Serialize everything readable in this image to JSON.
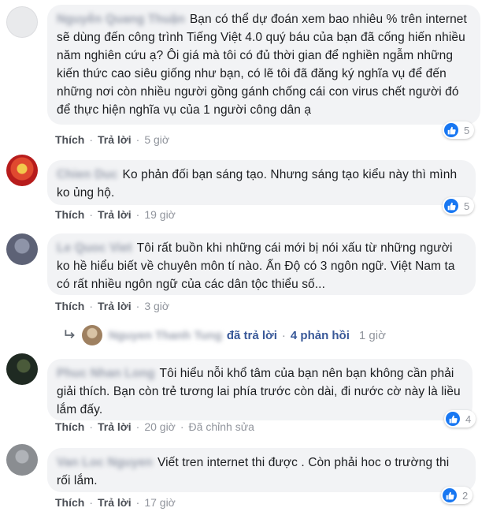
{
  "comments": [
    {
      "author": "Nguyễn Quang Thuận",
      "text": "Bạn có thể dự đoán xem bao nhiêu % trên internet sẽ dùng đến công trình Tiếng Việt 4.0 quý báu của bạn đã cống hiến nhiều năm nghiên cứu ạ? Ôi giá mà tôi có đủ thời gian để nghiền ngẫm những kiến thức cao siêu giống như bạn, có lẽ tôi đã đăng ký nghĩa vụ để đến những nơi còn nhiều người gồng gánh chống cái con virus chết người đó để thực hiện nghĩa vụ của 1 người công dân ạ",
      "like": "Thích",
      "reply": "Trả lời",
      "time": "5 giờ",
      "reactions": "5"
    },
    {
      "author": "Chien Duc",
      "text": "Ko phản đối bạn sáng tạo. Nhưng sáng tạo kiểu này thì mình ko ủng hộ.",
      "like": "Thích",
      "reply": "Trả lời",
      "time": "19 giờ",
      "reactions": "5"
    },
    {
      "author": "Le Quoc Viet",
      "text": "Tôi rất buồn khi những cái mới bị nói xấu từ những người ko hề hiểu biết về chuyên môn tí nào. Ấn Độ có 3 ngôn ngữ. Việt Nam ta có rất nhiều ngôn ngữ của các dân tộc thiểu số...",
      "like": "Thích",
      "reply": "Trả lời",
      "time": "3 giờ",
      "replies": {
        "name": "Nguyen Thanh Tung",
        "replied": "đã trả lời",
        "count": "4 phản hồi",
        "time": "1 giờ"
      }
    },
    {
      "author": "Phuc Nhan Long",
      "text": "Tôi hiểu nỗi khổ tâm của bạn nên bạn không cần phải giải thích. Bạn còn trẻ tương lai phía trước còn dài, đi nước cờ này là liều lắm đấy.",
      "like": "Thích",
      "reply": "Trả lời",
      "time": "20 giờ",
      "edited": "Đã chỉnh sửa",
      "reactions": "4"
    },
    {
      "author": "Van Loc Nguyen",
      "text": "Viết tren internet thi được . Còn phải hoc o trường thi rối lắm.",
      "like": "Thích",
      "reply": "Trả lời",
      "time": "17 giờ",
      "reactions": "2"
    }
  ],
  "colors": {
    "bubble": "#f2f3f5",
    "link": "#385898",
    "like_blue": "#1877f2",
    "meta": "#90949c"
  }
}
